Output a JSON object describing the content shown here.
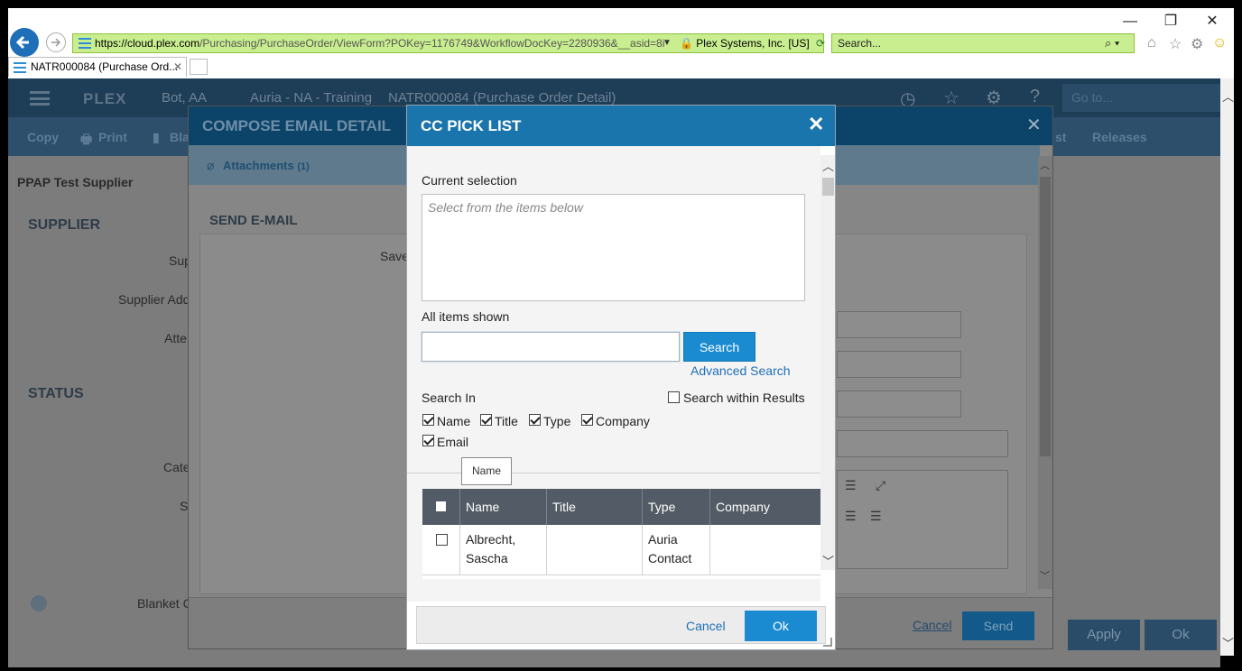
{
  "browser": {
    "url_prefix": "https://cloud.",
    "url_domain": "plex.com",
    "url_rest": "/Purchasing/PurchaseOrder/ViewForm?POKey=1176749&WorkflowDocKey=2280936&__asid=8i",
    "site_identity": "Plex Systems, Inc. [US]",
    "search_placeholder": "Search...",
    "tab_title": "NATR000084 (Purchase Ord...",
    "win_minimize": "—",
    "win_restore": "❐",
    "win_close": "✕"
  },
  "app": {
    "logo": "PLEX",
    "user": "Bot, AA",
    "environment": "Auria - NA - Training",
    "page_title": "NATR000084 (Purchase Order Detail)",
    "goto_placeholder": "Go to...",
    "toolbar": {
      "copy": "Copy",
      "print": "Print",
      "blank": "Bla",
      "list": "st",
      "releases": "Releases"
    },
    "supplier_name": "PPAP Test Supplier",
    "section_supplier": "SUPPLIER",
    "label_sup": "Sup",
    "label_supplier_add": "Supplier Add",
    "label_atte": "Atte",
    "section_status": "STATUS",
    "label_cate": "Cate",
    "label_s": "S",
    "label_blanket": "Blanket C",
    "footer_apply": "Apply",
    "footer_ok": "Ok"
  },
  "compose": {
    "title": "COMPOSE EMAIL DETAIL",
    "attachments_label": "Attachments",
    "attachments_count": "(1)",
    "send_email_header": "SEND E-MAIL",
    "save_label": "Save",
    "cancel_label": "Cancel",
    "send_label": "Send"
  },
  "picklist": {
    "title": "CC PICK LIST",
    "current_selection_label": "Current selection",
    "selection_placeholder": "Select from the items below",
    "all_items_label": "All items shown",
    "search_button": "Search",
    "advanced_search": "Advanced Search",
    "search_in_label": "Search In",
    "search_within_label": "Search within Results",
    "filters": [
      {
        "label": "Name",
        "checked": true
      },
      {
        "label": "Title",
        "checked": true
      },
      {
        "label": "Type",
        "checked": true
      },
      {
        "label": "Company",
        "checked": true
      },
      {
        "label": "Email",
        "checked": true
      }
    ],
    "tooltip": "Name",
    "columns": [
      "Name",
      "Title",
      "Type",
      "Company"
    ],
    "rows": [
      {
        "name": "Albrecht, Sascha",
        "title": "",
        "type": "Auria Contact",
        "company": ""
      }
    ],
    "cancel_label": "Cancel",
    "ok_label": "Ok"
  }
}
